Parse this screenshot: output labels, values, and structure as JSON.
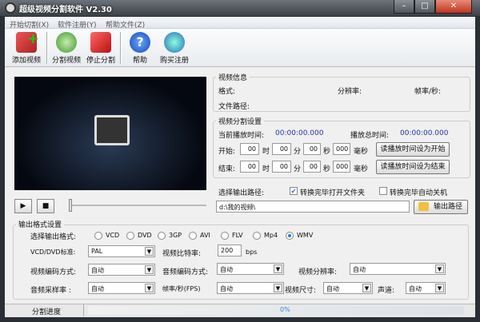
{
  "window": {
    "title": "超级视频分割软件 V2.30",
    "min": "–",
    "max": "□",
    "close": "✕"
  },
  "menu": [
    "开始切割(X)",
    "软件注册(Y)",
    "帮助文件(Z)"
  ],
  "toolbar": [
    "添加视频",
    "分割视频",
    "停止分割",
    "帮助",
    "购买注册"
  ],
  "player": {
    "play": "▶",
    "stop": "■"
  },
  "info": {
    "title": "视频信息",
    "format": "格式:",
    "resolution": "分辨率:",
    "fps": "帧率/秒:",
    "path": "文件路径:"
  },
  "split": {
    "title": "视频分割设置",
    "current_label": "当前播放时间:",
    "current": "00:00:00.000",
    "total_label": "播放总时间:",
    "total": "00:00:00.000",
    "start": "开始:",
    "end": "结束:",
    "h": "时",
    "m": "分",
    "s": "秒",
    "ms": "毫秒",
    "hv": "00",
    "mv": "00",
    "sv": "00",
    "msv": "000",
    "set_start": "读播放时间设为开始",
    "set_end": "读播放时间设为结束"
  },
  "output": {
    "label": "选择输出路径:",
    "open_folder": "转换完毕打开文件夹",
    "open_folder_checked": true,
    "shutdown": "转换完毕自动关机",
    "shutdown_checked": false,
    "path": "d:\\我的视频\\",
    "button": "输出路径"
  },
  "format": {
    "title": "输出格式设置",
    "select_label": "选择输出格式:",
    "options": [
      "VCD",
      "DVD",
      "3GP",
      "AVI",
      "FLV",
      "Mp4",
      "WMV"
    ],
    "selected": "WMV",
    "std_label": "VCD/DVD标准:",
    "std": "PAL",
    "bitrate_label": "视频比特率:",
    "bitrate": "200",
    "bitrate_unit": "bps",
    "vcodec_label": "视频编码方式:",
    "vcodec": "自动",
    "acodec_label": "音频编码方式:",
    "acodec": "自动",
    "vres_label": "视频分辨率:",
    "vres": "自动",
    "asr_label": "音频采样率 :",
    "asr": "自动",
    "fps_label": "帧率/秒(FPS)",
    "fps": "自动",
    "vsize_label": "视频尺寸:",
    "vsize": "自动",
    "channel_label": "声道:",
    "channel": "自动"
  },
  "status": {
    "label": "分割进度",
    "progress": "0%",
    "progress_value": 0
  }
}
